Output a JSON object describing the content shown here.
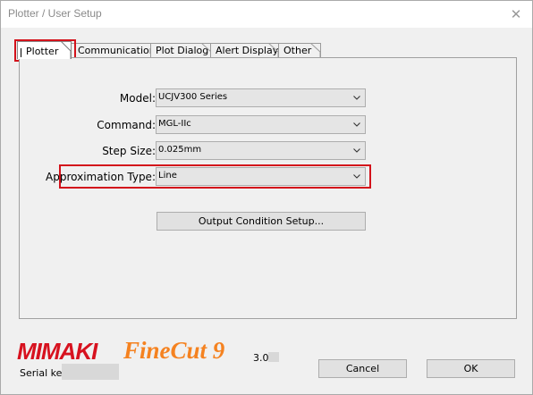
{
  "window": {
    "title": "Plotter / User Setup",
    "close_glyph": "✕"
  },
  "tabs": [
    {
      "label": "Plotter",
      "active": true
    },
    {
      "label": "Communication",
      "active": false
    },
    {
      "label": "Plot Dialog",
      "active": false
    },
    {
      "label": "Alert Display",
      "active": false
    },
    {
      "label": "Other",
      "active": false
    }
  ],
  "form": {
    "model_label": "Model:",
    "model_value": "UCJV300 Series",
    "command_label": "Command:",
    "command_value": "MGL-IIc",
    "step_size_label": "Step Size:",
    "step_size_value": "0.025mm",
    "approx_label": "Approximation Type:",
    "approx_value": "Line",
    "output_button": "Output Condition Setup..."
  },
  "footer": {
    "brand": "MIMAKI",
    "product": "FineCut 9",
    "version": "3.0",
    "serial_label": "Serial key:",
    "cancel": "Cancel",
    "ok": "OK"
  },
  "colors": {
    "highlight": "#d3121b",
    "brand_red": "#d7121f",
    "brand_orange": "#f58220"
  },
  "icons": {
    "close": "close-icon",
    "dropdown": "chevron-down-icon"
  }
}
